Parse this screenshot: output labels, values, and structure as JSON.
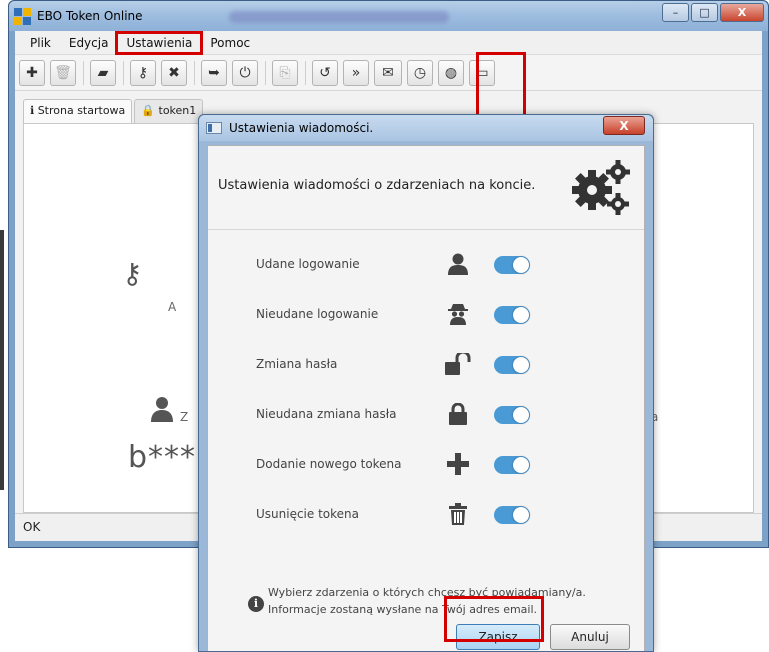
{
  "app": {
    "title": "EBO Token Online",
    "window_buttons": {
      "minimize": "–",
      "maximize": "□",
      "close": "X"
    }
  },
  "menu": {
    "items": [
      {
        "label": "Plik"
      },
      {
        "label": "Edycja"
      },
      {
        "label": "Ustawienia"
      },
      {
        "label": "Pomoc"
      }
    ]
  },
  "toolbar": {
    "buttons": [
      {
        "icon": "plus-icon",
        "glyph": "✚"
      },
      {
        "icon": "trash-icon",
        "glyph": "🗑"
      },
      {
        "icon": "book-icon",
        "glyph": "▰"
      },
      {
        "icon": "key-icon",
        "glyph": "⚷"
      },
      {
        "icon": "remove-user-icon",
        "glyph": "✖"
      },
      {
        "icon": "export-icon",
        "glyph": "➥"
      },
      {
        "icon": "power-icon",
        "glyph": "⏻"
      },
      {
        "icon": "copy-icon",
        "glyph": "⎘"
      },
      {
        "icon": "history-icon",
        "glyph": "↺"
      },
      {
        "icon": "more-icon",
        "glyph": "»"
      },
      {
        "icon": "envelope-icon",
        "glyph": "✉"
      },
      {
        "icon": "clock-icon",
        "glyph": "◷"
      },
      {
        "icon": "globe-icon",
        "glyph": "◍"
      },
      {
        "icon": "monitor-icon",
        "glyph": "▭"
      }
    ]
  },
  "tabs": [
    {
      "icon": "info-icon",
      "glyph": "ℹ",
      "label": "Strona startowa"
    },
    {
      "icon": "lock-icon",
      "glyph": "🔒",
      "label": "token1"
    }
  ],
  "background": {
    "a_text": "A",
    "z_text": "Z",
    "masked_user": "b***",
    "nia_text": "nia"
  },
  "status": {
    "text": "OK"
  },
  "dialog": {
    "title": "Ustawienia wiadomości.",
    "close": "X",
    "heading": "Ustawienia wiadomości o zdarzeniach na koncie.",
    "options": [
      {
        "label": "Udane logowanie",
        "icon": "user-icon",
        "enabled": true
      },
      {
        "label": "Nieudane logowanie",
        "icon": "spy-icon",
        "enabled": true
      },
      {
        "label": "Zmiana hasła",
        "icon": "unlock-icon",
        "enabled": true
      },
      {
        "label": "Nieudana zmiana hasła",
        "icon": "lock-icon",
        "enabled": true
      },
      {
        "label": "Dodanie nowego tokena",
        "icon": "plus-icon",
        "enabled": true
      },
      {
        "label": "Usunięcie tokena",
        "icon": "trash-icon",
        "enabled": true
      }
    ],
    "info_line1": "Wybierz zdarzenia o których chcesz być powiadamiany/a.",
    "info_line2": "Informacje zostaną wysłane na Twój adres email.",
    "save": "Zapisz",
    "cancel": "Anuluj"
  },
  "colors": {
    "accent": "#4a9ad6",
    "annotation": "#d40000"
  }
}
